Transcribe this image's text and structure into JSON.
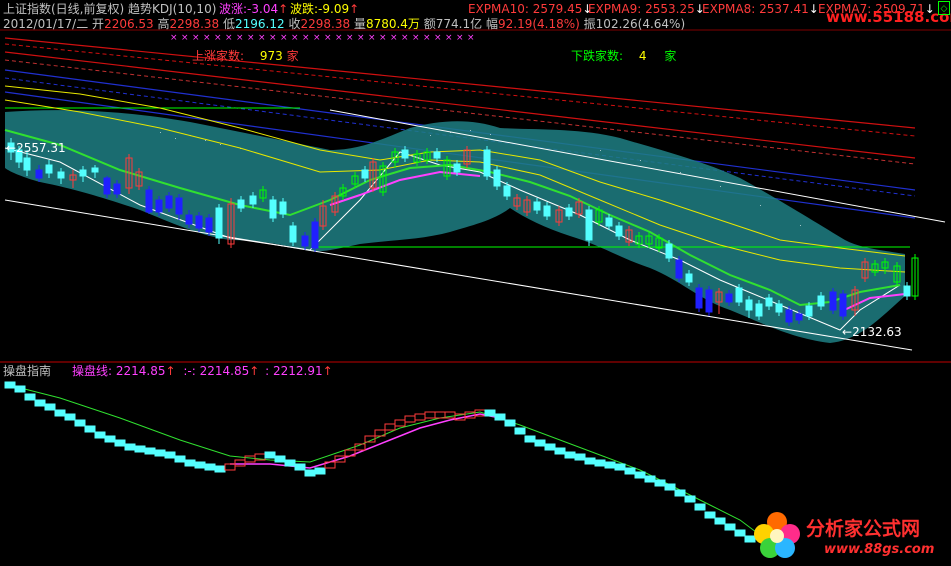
{
  "header": {
    "index_name": "上证指数(日线,前复权)",
    "indicator": "趋势KDJ(10,10)",
    "wave_up_label": "波涨:",
    "wave_up_value": "-3.04",
    "wave_down_label": "波跌:",
    "wave_down_value": "-9.09",
    "expma10": "EXPMA10: 2579.45",
    "expma9": "EXPMA9: 2553.25",
    "expma8": "EXPMA8: 2537.41",
    "expma7": "EXPMA7: 2509.71",
    "watermark_top": "www.55188.com"
  },
  "ohlc_bar": {
    "date": "2012/01/17/二",
    "open_label": "开",
    "open": "2206.53",
    "high_label": "高",
    "high": "2298.38",
    "low_label": "低",
    "low": "2196.12",
    "close_label": "收",
    "close": "2298.38",
    "volume_label": "量",
    "volume": "8780.4万",
    "amount_label": "额",
    "amount": "774.1亿",
    "change_label": "幅",
    "change": "92.19(4.18%)",
    "amplitude_label": "振",
    "amplitude": "102.26(4.64%)"
  },
  "breadth": {
    "up_label": "上涨家数:",
    "up_count": "973",
    "up_unit": "家",
    "down_label": "下跌家数:",
    "down_count": "4",
    "down_unit": "家"
  },
  "price_labels": {
    "high_mark": "2557.31",
    "low_mark": "2132.63"
  },
  "sub_panel": {
    "title": "操盘指南",
    "line_label": "操盘线:",
    "line_value": "2214.85",
    "sep_value": ":-: 2214.85",
    "value3": ": 2212.91"
  },
  "watermark": {
    "name": "分析家公式网",
    "url": "www.88gs.com"
  },
  "colors": {
    "up": "#ff3b3b",
    "down": "#54ffff",
    "text_label": "#c0c0c0",
    "yellow": "#ffff00",
    "magenta": "#ff00ff",
    "green": "#00ff00",
    "cloud": "#1f7f84",
    "background": "#000000"
  }
}
